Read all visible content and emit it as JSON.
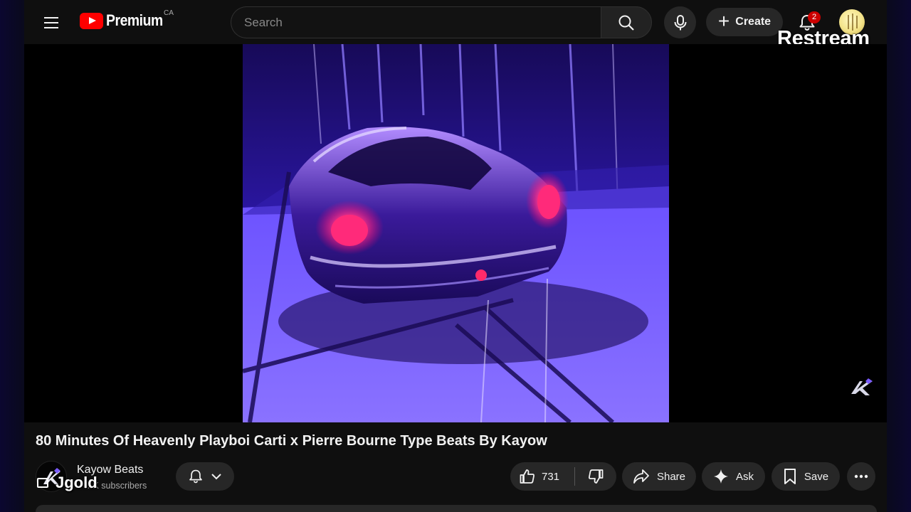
{
  "header": {
    "logo_text": "Premium",
    "region": "CA",
    "search_placeholder": "Search",
    "create_label": "Create",
    "notification_count": "2"
  },
  "overlay": {
    "restream_label": "Restream",
    "bottom_overlay_text": "Jgold"
  },
  "video": {
    "title": "80 Minutes Of Heavenly Playboi Carti x Pierre Bourne Type Beats By Kayow"
  },
  "channel": {
    "name": "Kayow Beats",
    "subscribers": "…K subscribers"
  },
  "actions": {
    "like_count": "731",
    "share_label": "Share",
    "ask_label": "Ask",
    "save_label": "Save"
  },
  "colors": {
    "background": "#0f0f0f",
    "pill": "#272727",
    "brand_red": "#ff0000",
    "video_purple": "#6a3cf0",
    "taillight": "#ff2a7a"
  },
  "icons": [
    "menu-icon",
    "youtube-logo-icon",
    "search-icon",
    "mic-icon",
    "plus-icon",
    "bell-icon",
    "thumbs-up-icon",
    "thumbs-down-icon",
    "share-icon",
    "sparkle-icon",
    "bookmark-icon",
    "more-horizontal-icon",
    "chevron-down-icon",
    "kayow-watermark-icon"
  ]
}
